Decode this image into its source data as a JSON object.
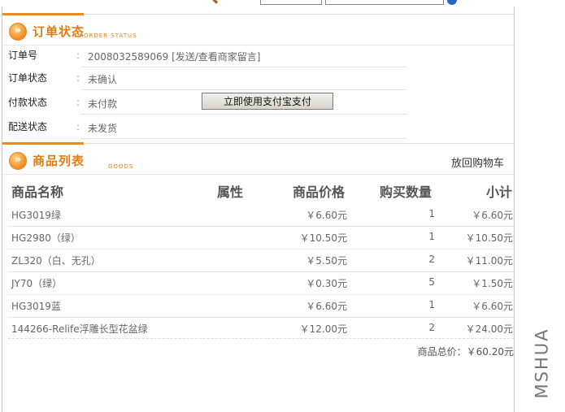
{
  "order_section": {
    "title": "订单状态",
    "subtitle": "ORDER STATUS",
    "rows": [
      {
        "label": "订单号",
        "value": "2008032589069 [发送/查看商家留言]"
      },
      {
        "label": "订单状态",
        "value": "未确认"
      },
      {
        "label": "付款状态",
        "value": "未付款"
      },
      {
        "label": "配送状态",
        "value": "未发货"
      }
    ],
    "pay_button": "立即使用支付宝支付"
  },
  "goods_section": {
    "title": "商品列表",
    "subtitle": "GOODS",
    "back_link": "放回购物车",
    "headers": [
      "商品名称",
      "属性",
      "商品价格",
      "购买数量",
      "小计"
    ],
    "items": [
      {
        "name": "HG3019绿",
        "price": "￥6.60元",
        "qty": "1",
        "subtotal": "￥6.60元"
      },
      {
        "name": "HG2980（绿）",
        "price": "￥10.50元",
        "qty": "1",
        "subtotal": "￥10.50元"
      },
      {
        "name": "ZL320（白、无孔）",
        "price": "￥5.50元",
        "qty": "2",
        "subtotal": "￥11.00元"
      },
      {
        "name": "JY70（绿）",
        "price": "￥0.30元",
        "qty": "5",
        "subtotal": "￥1.50元"
      },
      {
        "name": "HG3019蓝",
        "price": "￥6.60元",
        "qty": "1",
        "subtotal": "￥6.60元"
      },
      {
        "name": "144266-Relife浮雕长型花盆绿",
        "price": "￥12.00元",
        "qty": "2",
        "subtotal": "￥24.00元"
      }
    ],
    "total": "商品总价：￥60.20元"
  },
  "watermark": "MSHUA",
  "icons": {
    "bullet": "chevron-right-icon"
  },
  "colors": {
    "accent": "#f08a1e",
    "title": "#e07d12"
  }
}
